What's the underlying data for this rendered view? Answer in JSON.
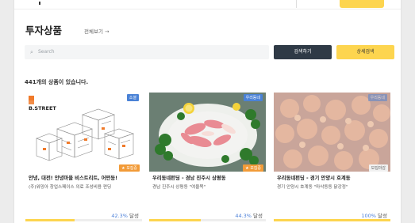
{
  "header": {
    "title": "투자상품",
    "view_all": "전체보기 →"
  },
  "search": {
    "placeholder": "Search",
    "search_button": "검색하기",
    "detail_button": "상세검색"
  },
  "result_count": "441개의 상품이 있습니다.",
  "cards": [
    {
      "title": "안녕, 대전! 안녕마을 비스트리트, 어떤동!",
      "subtitle": "(주)워밍아 창업스페이스 의료 조성비용 펀딩",
      "top_badge": "소셜",
      "bottom_badge": "★ 모집중",
      "brand": "B.STREET",
      "percent": "42.3%",
      "percent_suffix": " 달성",
      "progress": 0.423
    },
    {
      "title": "우리동네펀딩 - 경남 진주시 상평동",
      "subtitle": "경남 진주시 상평동 \"여울목\"",
      "top_badge": "우리동네",
      "bottom_badge": "★ 모집중",
      "percent": "44.3%",
      "percent_suffix": " 달성",
      "progress": 0.443
    },
    {
      "title": "우리동네펀딩 - 경기 안양시 호계동",
      "subtitle": "경기 안양시 호계동 \"마삭동동 닭강정\"",
      "top_badge": "우리동네",
      "bottom_badge": "모집마감",
      "percent": "100%",
      "percent_suffix": " 달성",
      "progress": 1.0
    }
  ],
  "colors": {
    "accent": "#fdd54f",
    "dark_button": "#2f3a46",
    "blue_badge": "#4a82d6",
    "orange_badge": "#f29b38",
    "percent_blue": "#4a7fd8"
  }
}
